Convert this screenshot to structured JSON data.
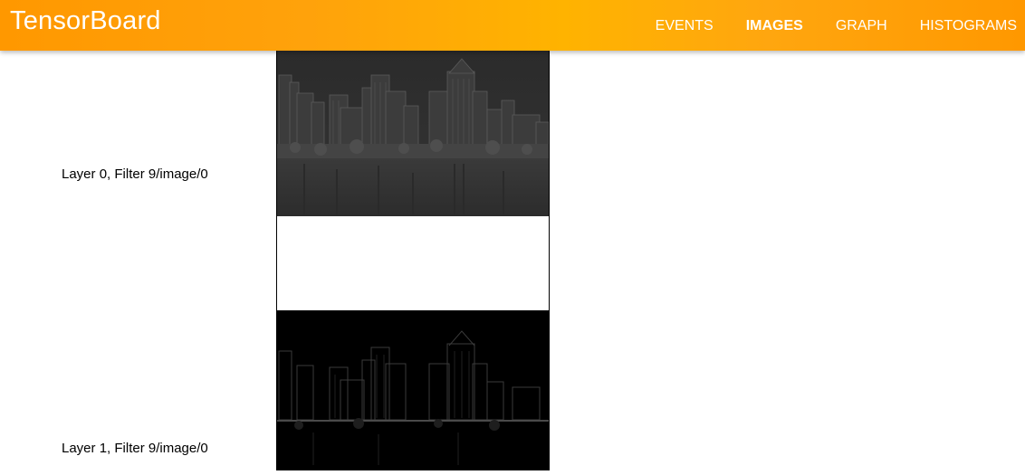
{
  "app": {
    "title": "TensorBoard",
    "accent": "#ff9800"
  },
  "nav": {
    "tabs": [
      {
        "label": "EVENTS",
        "selected": false
      },
      {
        "label": "IMAGES",
        "selected": true
      },
      {
        "label": "GRAPH",
        "selected": false
      },
      {
        "label": "HISTOGRAMS",
        "selected": false
      }
    ]
  },
  "images": [
    {
      "label": "Layer 0, Filter 9/image/0",
      "icon": "city-skyline-filter-map-gray"
    },
    {
      "label": "Layer 1, Filter 9/image/0",
      "icon": "city-skyline-filter-map-dark"
    }
  ]
}
